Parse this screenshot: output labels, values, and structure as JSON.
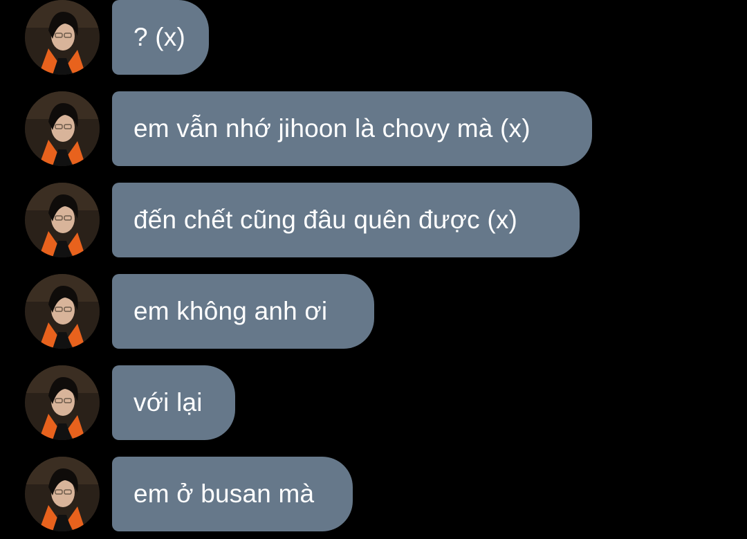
{
  "colors": {
    "background": "#000000",
    "bubble": "#66788a",
    "text": "#ffffff"
  },
  "messages": [
    {
      "text": "? (x)",
      "avatar": "profile-photo"
    },
    {
      "text": "em vẫn nhớ jihoon là chovy mà (x)",
      "avatar": "profile-photo"
    },
    {
      "text": "đến chết cũng đâu quên được (x)",
      "avatar": "profile-photo"
    },
    {
      "text": "em không anh ơi",
      "avatar": "profile-photo"
    },
    {
      "text": "với lại",
      "avatar": "profile-photo"
    },
    {
      "text": "em ở busan mà",
      "avatar": "profile-photo"
    }
  ]
}
